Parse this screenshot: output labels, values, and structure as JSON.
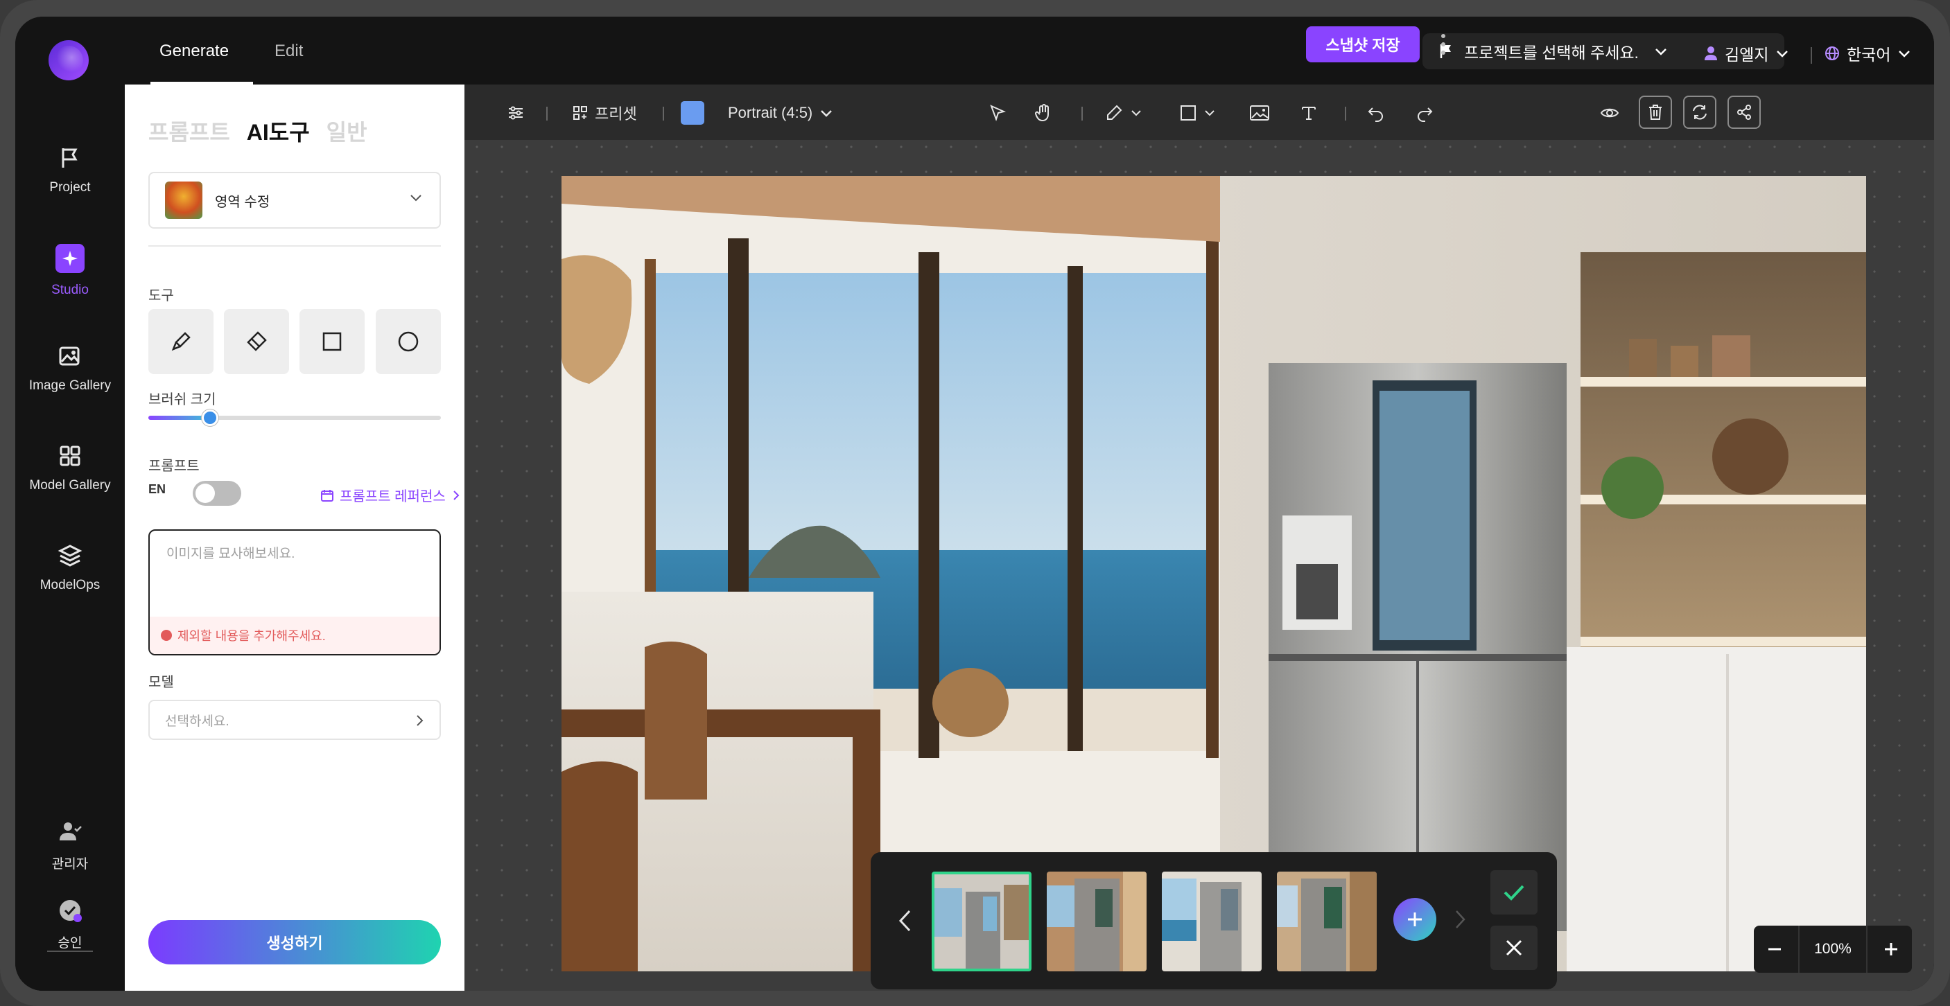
{
  "header": {
    "tabs": [
      {
        "label": "Generate"
      },
      {
        "label": "Edit"
      }
    ],
    "project_select": "프로젝트를 선택해 주세요.",
    "user": "김엘지",
    "language": "한국어"
  },
  "nav": {
    "items": [
      {
        "label": "Project",
        "icon": "flag-icon"
      },
      {
        "label": "Studio",
        "icon": "sparkle-icon"
      },
      {
        "label": "Image Gallery",
        "icon": "image-gallery-icon"
      },
      {
        "label": "Model Gallery",
        "icon": "grid-icon"
      },
      {
        "label": "ModelOps",
        "icon": "layers-icon"
      }
    ],
    "bottom": [
      {
        "label": "관리자",
        "icon": "admin-user-icon"
      },
      {
        "label": "승인",
        "icon": "approval-icon"
      }
    ]
  },
  "panel": {
    "tabs": [
      {
        "label": "프롬프트"
      },
      {
        "label": "AI도구"
      },
      {
        "label": "일반"
      }
    ],
    "mode_select": "영역 수정",
    "tools_label": "도구",
    "tools": [
      {
        "icon": "brush-icon"
      },
      {
        "icon": "eraser-icon"
      },
      {
        "icon": "rectangle-icon"
      },
      {
        "icon": "circle-icon"
      }
    ],
    "brush_size_label": "브러쉬 크기",
    "brush_size_fraction": 0.21,
    "prompt_label": "프롬프트",
    "prompt_en_toggle": "EN",
    "prompt_reference": "프롬프트 레퍼런스",
    "prompt_placeholder": "이미지를 묘사해보세요.",
    "prompt_warning": "제외할 내용을 추가해주세요.",
    "model_label": "모델",
    "model_placeholder": "선택하세요.",
    "generate_button": "생성하기"
  },
  "toolbar": {
    "preset_label": "프리셋",
    "color": "#6a9cf0",
    "aspect_label": "Portrait (4:5)",
    "save_label": "스냅샷 저장"
  },
  "thumbnails": {
    "count": 4,
    "active_index": 0
  },
  "zoom": {
    "value": "100%"
  },
  "colors": {
    "accent": "#8a44ff",
    "success": "#2fd38a",
    "danger": "#e25a5a"
  }
}
